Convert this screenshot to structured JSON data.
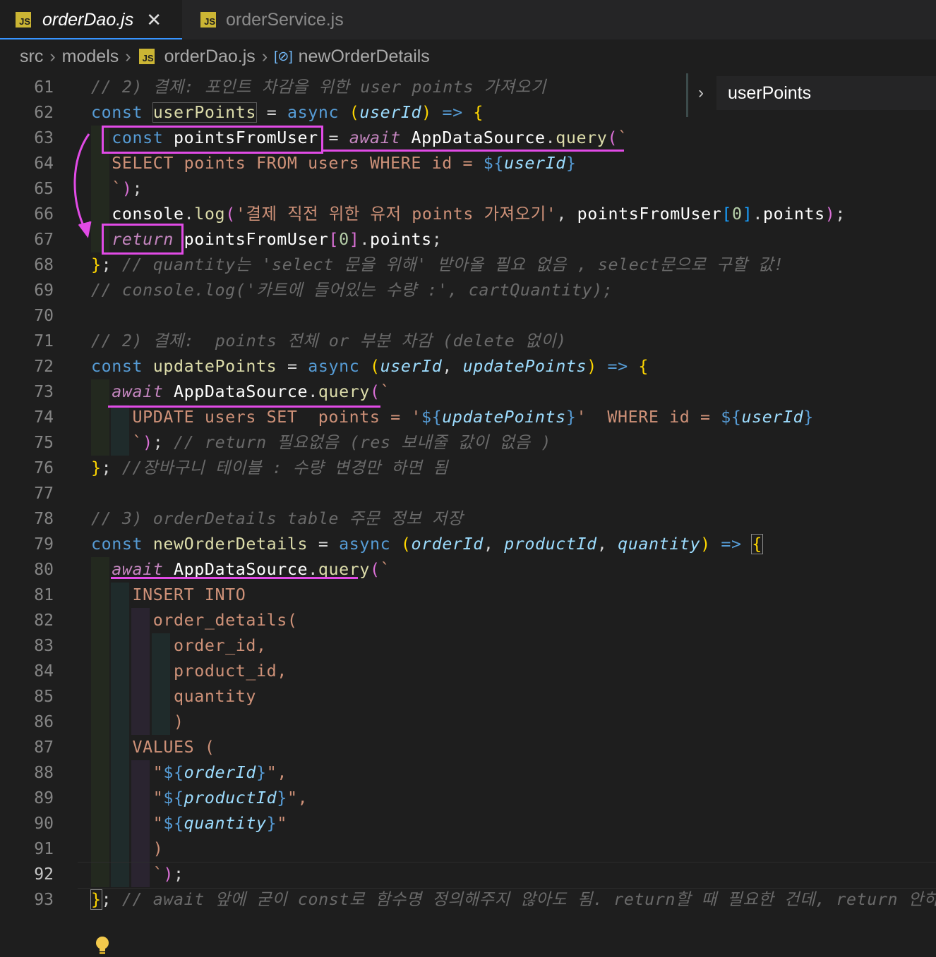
{
  "tabs": [
    {
      "label": "orderDao.js",
      "active": true,
      "icon": "js-file-icon",
      "icon_text": "JS"
    },
    {
      "label": "orderService.js",
      "active": false,
      "icon": "js-file-icon",
      "icon_text": "JS"
    }
  ],
  "breadcrumb": {
    "items": [
      "src",
      "models",
      "orderDao.js",
      "newOrderDetails"
    ],
    "symbol_icon": "[⊘]"
  },
  "sticky": {
    "label": "userPoints"
  },
  "line_numbers": [
    "61",
    "62",
    "63",
    "64",
    "65",
    "66",
    "67",
    "68",
    "69",
    "70",
    "71",
    "72",
    "73",
    "74",
    "75",
    "76",
    "77",
    "78",
    "79",
    "80",
    "81",
    "82",
    "83",
    "84",
    "85",
    "86",
    "87",
    "88",
    "89",
    "90",
    "91",
    "92",
    "93"
  ],
  "current_line": "92",
  "code_lines": [
    "// 2) 결제: 포인트 차감을 위한 user points 가져오기",
    "const userPoints = async (userId) => {",
    "  const pointsFromUser = await AppDataSource.query(`",
    "  SELECT points FROM users WHERE id = ${userId}",
    "  `);",
    "  console.log('결제 직전 위한 유저 points 가져오기', pointsFromUser[0].points);",
    "  return pointsFromUser[0].points;",
    "}; // quantity는 'select 문을 위해' 받아올 필요 없음 , select문으로 구할 값!",
    "// console.log('카트에 들어있는 수량 :', cartQuantity);",
    "",
    "// 2) 결제:  points 전체 or 부분 차감 (delete 없이)",
    "const updatePoints = async (userId, updatePoints) => {",
    "  await AppDataSource.query(`",
    "    UPDATE users SET  points = '${updatePoints}'  WHERE id = ${userId}",
    "    `); // return 필요없음 (res 보내줄 값이 없음 )",
    "}; //장바구니 테이블 : 수량 변경만 하면 됨",
    "",
    "// 3) orderDetails table 주문 정보 저장",
    "const newOrderDetails = async (orderId, productId, quantity) => {",
    "  await AppDataSource.query(`",
    "    INSERT INTO",
    "      order_details(",
    "        order_id,",
    "        product_id,",
    "        quantity",
    "        )",
    "    VALUES (",
    "      \"${orderId}\",",
    "      \"${productId}\",",
    "      \"${quantity}\"",
    "      )",
    "      `);",
    "}; // await 앞에 굳이 const로 함수명 정의해주지 않아도 됨. return할 때 필요한 건데, return 안하니"
  ],
  "colors": {
    "background": "#1e1e1e",
    "keyword": "#c586c0",
    "storage": "#569cd6",
    "function": "#dcdcaa",
    "parameter": "#9cdcfe",
    "string": "#ce9178",
    "comment": "#6a6a6a",
    "annotation_magenta": "#e14be6"
  }
}
